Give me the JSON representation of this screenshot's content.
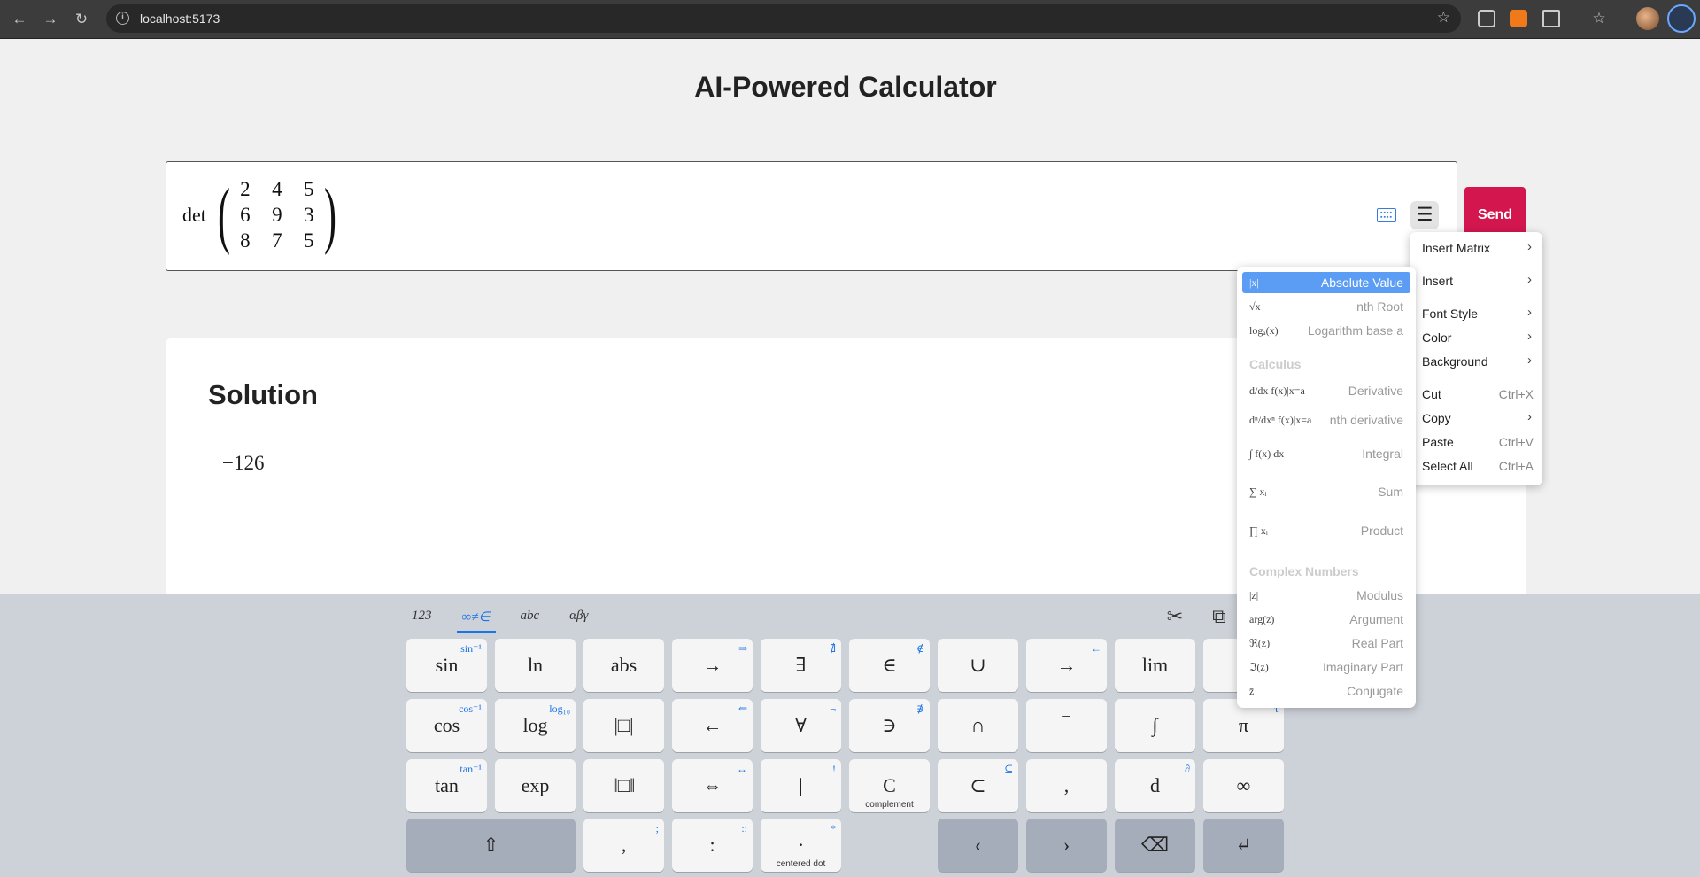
{
  "browser": {
    "url": "localhost:5173",
    "back_icon": "arrow-left-icon",
    "forward_icon": "arrow-right-icon",
    "reload_icon": "reload-icon"
  },
  "page": {
    "title": "AI-Powered Calculator",
    "input": {
      "operator": "det",
      "matrix": [
        [
          "2",
          "4",
          "5"
        ],
        [
          "6",
          "9",
          "3"
        ],
        [
          "8",
          "7",
          "5"
        ]
      ]
    },
    "send_label": "Send",
    "solution_title": "Solution",
    "solution_value": "−126"
  },
  "keyboard": {
    "tabs": [
      "123",
      "∞≠∈",
      "abc",
      "αβγ"
    ],
    "active_tab": 1,
    "rows": [
      [
        {
          "label": "sin",
          "shift": "sin⁻¹"
        },
        {
          "label": "ln",
          "shift": ""
        },
        {
          "label": "abs",
          "shift": ""
        },
        {
          "label": "→",
          "shift": "⇒"
        },
        {
          "label": "∃",
          "shift": "∄"
        },
        {
          "label": "∈",
          "shift": "∉"
        },
        {
          "label": "∪",
          "shift": ""
        },
        {
          "label": "→",
          "shift": "←"
        },
        {
          "label": "lim",
          "shift": ""
        },
        {
          "label": "",
          "shift": ""
        }
      ],
      [
        {
          "label": "cos",
          "shift": "cos⁻¹"
        },
        {
          "label": "log",
          "shift": "log₁₀"
        },
        {
          "label": "|□|",
          "shift": ""
        },
        {
          "label": "←",
          "shift": "⇐"
        },
        {
          "label": "∀",
          "shift": "¬"
        },
        {
          "label": "∋",
          "shift": "∌"
        },
        {
          "label": "∩",
          "shift": ""
        },
        {
          "label": "‾",
          "shift": ""
        },
        {
          "label": "∫",
          "shift": ""
        },
        {
          "label": "π",
          "shift": "τ"
        }
      ],
      [
        {
          "label": "tan",
          "shift": "tan⁻¹"
        },
        {
          "label": "exp",
          "shift": ""
        },
        {
          "label": "‖□‖",
          "shift": ""
        },
        {
          "label": "⇔",
          "shift": "↔"
        },
        {
          "label": "|",
          "shift": "!"
        },
        {
          "label": "C",
          "shift": "",
          "caption": "complement"
        },
        {
          "label": "⊂",
          "shift": "⊆"
        },
        {
          "label": ",",
          "shift": ""
        },
        {
          "label": "d",
          "shift": "∂"
        },
        {
          "label": "∞",
          "shift": ""
        }
      ],
      [
        {
          "label": "⇧",
          "shift": ""
        },
        {
          "label": ",",
          "shift": ";"
        },
        {
          "label": ":",
          "shift": "::"
        },
        {
          "label": "·",
          "shift": "*",
          "caption": "centered dot"
        },
        {
          "label": "‹",
          "shift": ""
        },
        {
          "label": "›",
          "shift": ""
        },
        {
          "label": "⌫",
          "shift": ""
        },
        {
          "label": "↵",
          "shift": ""
        }
      ]
    ]
  },
  "context_menu": {
    "items": [
      {
        "label": "Insert Matrix",
        "shortcut": "",
        "submenu": true
      },
      {
        "label": "Insert",
        "shortcut": "",
        "submenu": true
      },
      {
        "label": "Font Style",
        "shortcut": "",
        "submenu": true
      },
      {
        "label": "Color",
        "shortcut": "",
        "submenu": true
      },
      {
        "label": "Background",
        "shortcut": "",
        "submenu": true
      },
      {
        "label": "Cut",
        "shortcut": "Ctrl+X",
        "submenu": false
      },
      {
        "label": "Copy",
        "shortcut": "",
        "submenu": true
      },
      {
        "label": "Paste",
        "shortcut": "Ctrl+V",
        "submenu": false
      },
      {
        "label": "Select All",
        "shortcut": "Ctrl+A",
        "submenu": false
      }
    ]
  },
  "insert_submenu": {
    "items": [
      {
        "glyph": "|x|",
        "label": "Absolute Value",
        "highlighted": true
      },
      {
        "glyph": "√x",
        "label": "nth Root",
        "highlighted": false
      },
      {
        "glyph": "logₐ(x)",
        "label": "Logarithm base a",
        "highlighted": false
      }
    ],
    "calculus_heading": "Calculus",
    "calculus": [
      {
        "glyph": "d/dx f(x)|x=a",
        "label": "Derivative"
      },
      {
        "glyph": "dⁿ/dxⁿ f(x)|x=a",
        "label": "nth derivative"
      },
      {
        "glyph": "∫ f(x) dx",
        "label": "Integral"
      },
      {
        "glyph": "∑ xᵢ",
        "label": "Sum"
      },
      {
        "glyph": "∏ xᵢ",
        "label": "Product"
      }
    ],
    "complex_heading": "Complex Numbers",
    "complex": [
      {
        "glyph": "|z|",
        "label": "Modulus"
      },
      {
        "glyph": "arg(z)",
        "label": "Argument"
      },
      {
        "glyph": "ℜ(z)",
        "label": "Real Part"
      },
      {
        "glyph": "ℑ(z)",
        "label": "Imaginary Part"
      },
      {
        "glyph": "z̄",
        "label": "Conjugate"
      }
    ]
  }
}
